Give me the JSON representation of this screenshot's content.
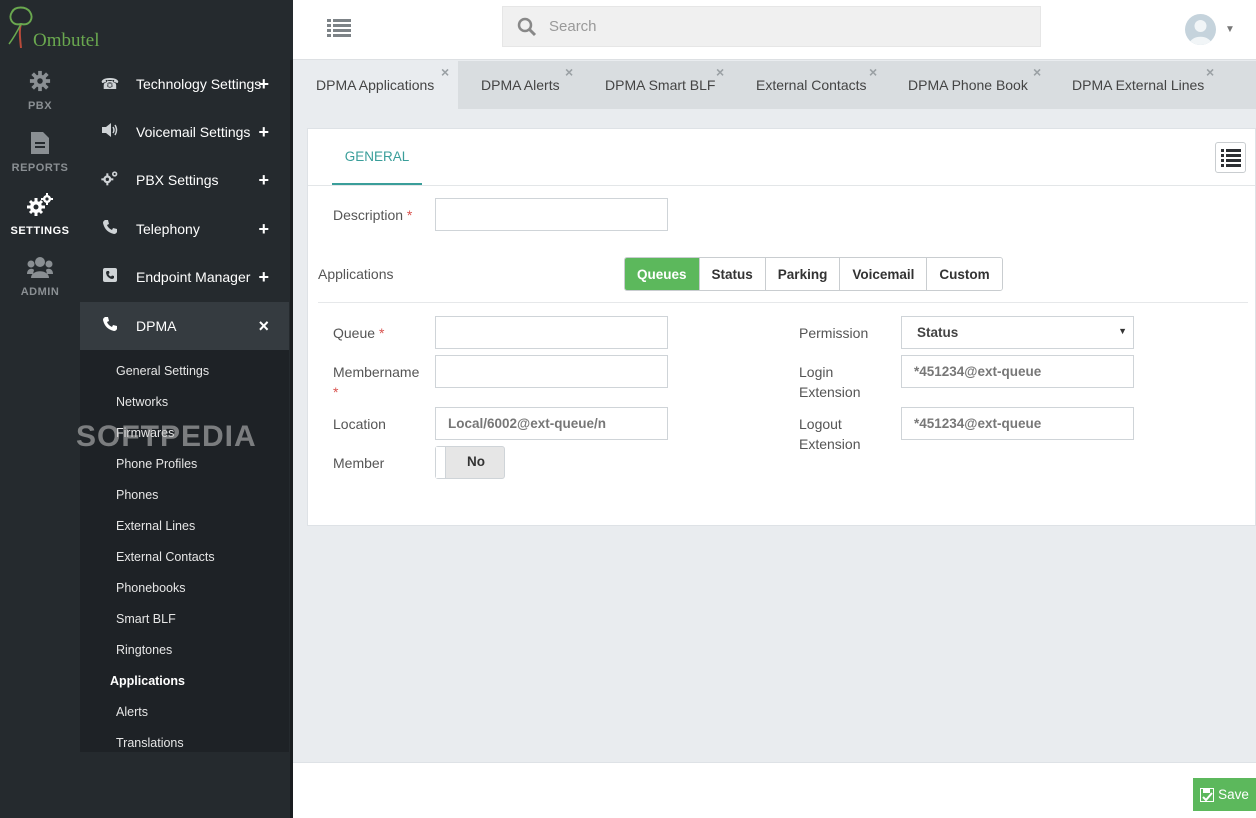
{
  "app": {
    "logo_text": "Ombutel"
  },
  "rail": [
    {
      "label": "PBX",
      "icon": "gear-icon"
    },
    {
      "label": "REPORTS",
      "icon": "document-icon"
    },
    {
      "label": "SETTINGS",
      "icon": "gears-icon"
    },
    {
      "label": "ADMIN",
      "icon": "users-icon"
    }
  ],
  "nav": {
    "items": [
      {
        "label": "Technology Settings",
        "toggle": "+",
        "icon": "phone-icon"
      },
      {
        "label": "Voicemail Settings",
        "toggle": "+",
        "icon": "volume-icon"
      },
      {
        "label": "PBX Settings",
        "toggle": "+",
        "icon": "gears-icon"
      },
      {
        "label": "Telephony",
        "toggle": "+",
        "icon": "handset-icon"
      },
      {
        "label": "Endpoint Manager",
        "toggle": "+",
        "icon": "phone-square-icon"
      },
      {
        "label": "DPMA",
        "toggle": "×",
        "icon": "handset-icon"
      }
    ],
    "sub_items": [
      "General Settings",
      "Networks",
      "Firmwares",
      "Phone Profiles",
      "Phones",
      "External Lines",
      "External Contacts",
      "Phonebooks",
      "Smart BLF",
      "Ringtones",
      "Applications",
      "Alerts",
      "Translations"
    ],
    "active_sub": "Applications"
  },
  "watermark": "SOFTPEDIA",
  "search": {
    "placeholder": "Search"
  },
  "tabs": [
    {
      "label": "DPMA Applications",
      "active": true
    },
    {
      "label": "DPMA Alerts"
    },
    {
      "label": "DPMA Smart BLF"
    },
    {
      "label": "External Contacts"
    },
    {
      "label": "DPMA Phone Book"
    },
    {
      "label": "DPMA External Lines"
    }
  ],
  "form": {
    "section_tab": "GENERAL",
    "description_label": "Description",
    "description_value": "",
    "applications_label": "Applications",
    "app_types": [
      "Queues",
      "Status",
      "Parking",
      "Voicemail",
      "Custom"
    ],
    "app_type_selected": "Queues",
    "queue_label": "Queue",
    "queue_value": "",
    "membername_label": "Membername",
    "membername_value": "",
    "location_label": "Location",
    "location_placeholder": "Local/6002@ext-queue/n",
    "member_label": "Member",
    "member_value": "No",
    "permission_label": "Permission",
    "permission_value": "Status",
    "login_ext_label_1": "Login",
    "login_ext_label_2": "Extension",
    "login_ext_placeholder": "*451234@ext-queue",
    "logout_ext_label_1": "Logout",
    "logout_ext_label_2": "Extension",
    "logout_ext_placeholder": "*451234@ext-queue",
    "required_mark": "*"
  },
  "footer": {
    "save_label": "Save"
  },
  "colors": {
    "accent": "#5cb85c",
    "teal": "#3a9e9a",
    "sidebar": "#252a2e"
  }
}
